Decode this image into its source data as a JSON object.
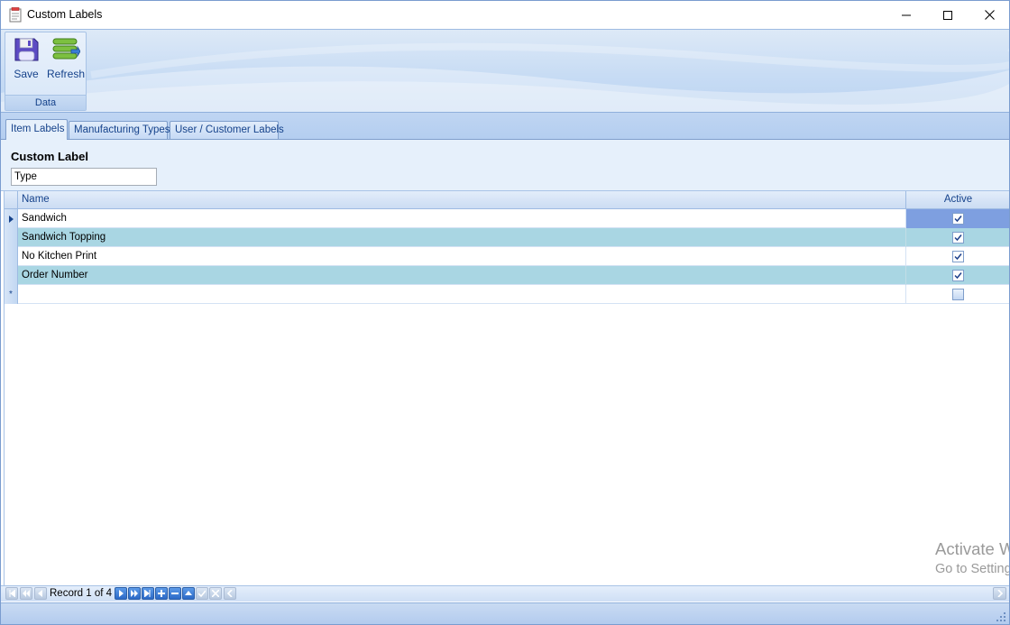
{
  "window": {
    "title": "Custom Labels",
    "icon": "document-icon"
  },
  "ribbon": {
    "group_caption": "Data",
    "save_label": "Save",
    "refresh_label": "Refresh"
  },
  "tabs": [
    {
      "label": "Item Labels",
      "active": true
    },
    {
      "label": "Manufacturing Types",
      "active": false
    },
    {
      "label": "User / Customer Labels",
      "active": false
    }
  ],
  "custom_label": {
    "heading": "Custom Label",
    "value": "Type"
  },
  "grid": {
    "columns": [
      "Name",
      "Active"
    ],
    "rows": [
      {
        "name": "Sandwich",
        "active": true
      },
      {
        "name": "Sandwich Topping",
        "active": true
      },
      {
        "name": "No Kitchen Print",
        "active": true
      },
      {
        "name": "Order Number",
        "active": true
      }
    ],
    "new_row_indicator": "*"
  },
  "navigator": {
    "record_text": "Record 1 of 4"
  },
  "watermark": {
    "line1": "Activate Windows",
    "line2": "Go to Settings to activate Windows."
  },
  "colors": {
    "alt_row": "#a9d6e3",
    "selected_cell": "#7e9fe0",
    "ribbon_text": "#15428b"
  }
}
